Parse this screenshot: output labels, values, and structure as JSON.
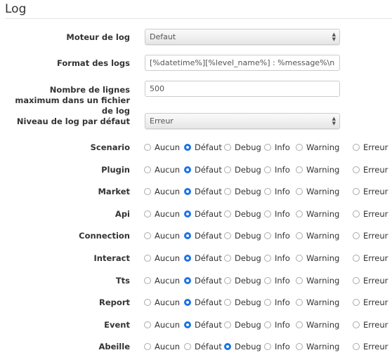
{
  "section_title": "Log",
  "fields": {
    "engine": {
      "label": "Moteur de log",
      "value": "Defaut"
    },
    "format": {
      "label": "Format des logs",
      "value": "[%datetime%][%level_name%] : %message%\\n"
    },
    "max_lines": {
      "label": "Nombre de lignes maximum dans un fichier de log",
      "value": "500"
    },
    "default_level": {
      "label": "Niveau de log par défaut",
      "value": "Erreur"
    }
  },
  "level_options": [
    "Aucun",
    "Défaut",
    "Debug",
    "Info",
    "Warning",
    "Erreur"
  ],
  "accent_color": "#1a73e8",
  "log_levels": [
    {
      "name": "Scenario",
      "selected": "Défaut"
    },
    {
      "name": "Plugin",
      "selected": "Défaut"
    },
    {
      "name": "Market",
      "selected": "Défaut"
    },
    {
      "name": "Api",
      "selected": "Défaut"
    },
    {
      "name": "Connection",
      "selected": "Défaut"
    },
    {
      "name": "Interact",
      "selected": "Défaut"
    },
    {
      "name": "Tts",
      "selected": "Défaut"
    },
    {
      "name": "Report",
      "selected": "Défaut"
    },
    {
      "name": "Event",
      "selected": "Défaut"
    },
    {
      "name": "Abeille",
      "selected": "Debug"
    }
  ]
}
